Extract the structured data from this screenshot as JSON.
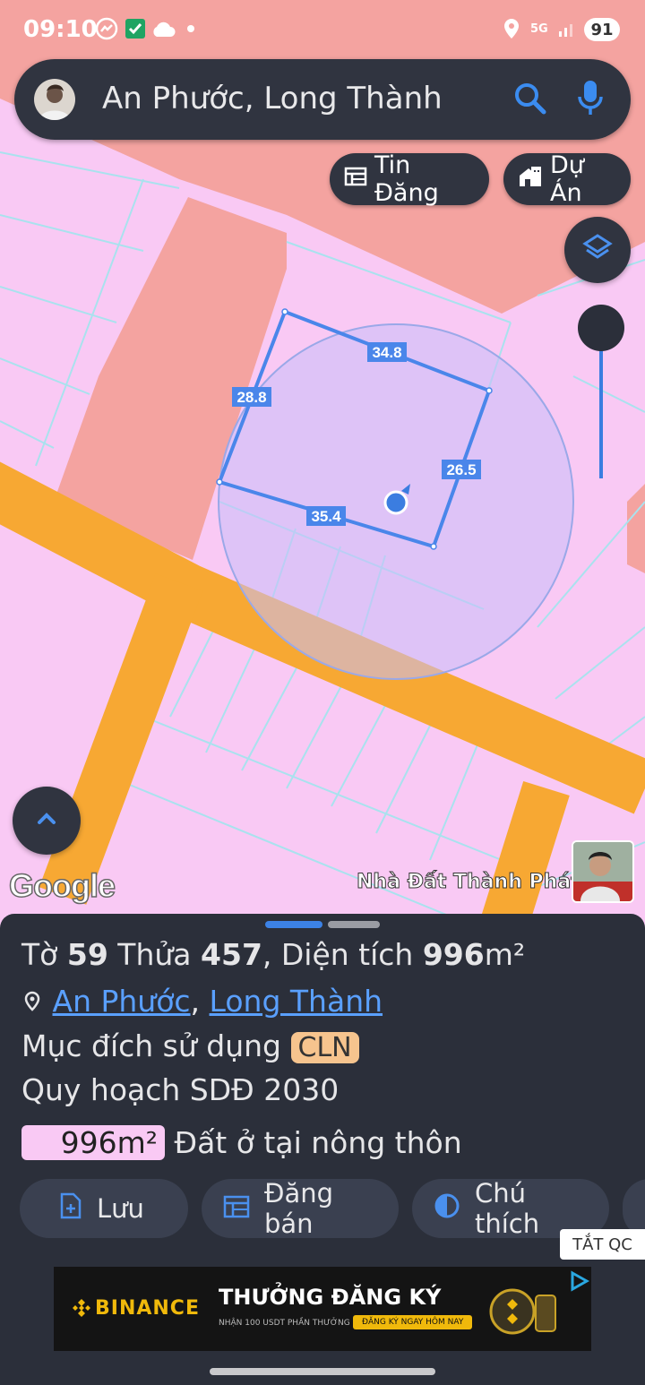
{
  "status": {
    "time": "09:10",
    "network": "5G",
    "battery": "91"
  },
  "search": {
    "query": "An Phước, Long Thành"
  },
  "map_buttons": {
    "tin_dang": "Tin Đăng",
    "du_an": "Dự Án"
  },
  "parcel_edges": {
    "top": "34.8",
    "left": "28.8",
    "right": "26.5",
    "bottom": "35.4"
  },
  "map_brand": {
    "google": "Google",
    "owner": "Nhà Đất Thành Phát"
  },
  "info": {
    "to_label": "Tờ",
    "to_value": "59",
    "thua_label": "Thửa",
    "thua_value": "457",
    "area_label": ", Diện tích",
    "area_value": "996",
    "area_unit": "m²",
    "ward": "An Phước",
    "district": "Long Thành",
    "separator": ",",
    "purpose_label": "Mục đích sử dụng",
    "purpose_code": "CLN",
    "plan_label": "Quy hoạch SDĐ 2030",
    "plan_area": "996m²",
    "plan_type": "Đất ở tại nông thôn"
  },
  "actions": {
    "save": "Lưu",
    "post": "Đăng bán",
    "legend": "Chú thích"
  },
  "ad": {
    "close": "TẮT QC",
    "brand": "BINANCE",
    "headline": "THƯỞNG ĐĂNG KÝ",
    "sub": "NHẬN 100 USDT PHẦN THƯỞNG",
    "cta": "ĐĂNG KÝ NGAY HÔM NAY"
  },
  "colors": {
    "parcel_fill": "#f9c9f4",
    "residential": "#f4a3a0",
    "road": "#f7a833",
    "accent": "#3b7de0",
    "panel": "#2b2f3a"
  }
}
